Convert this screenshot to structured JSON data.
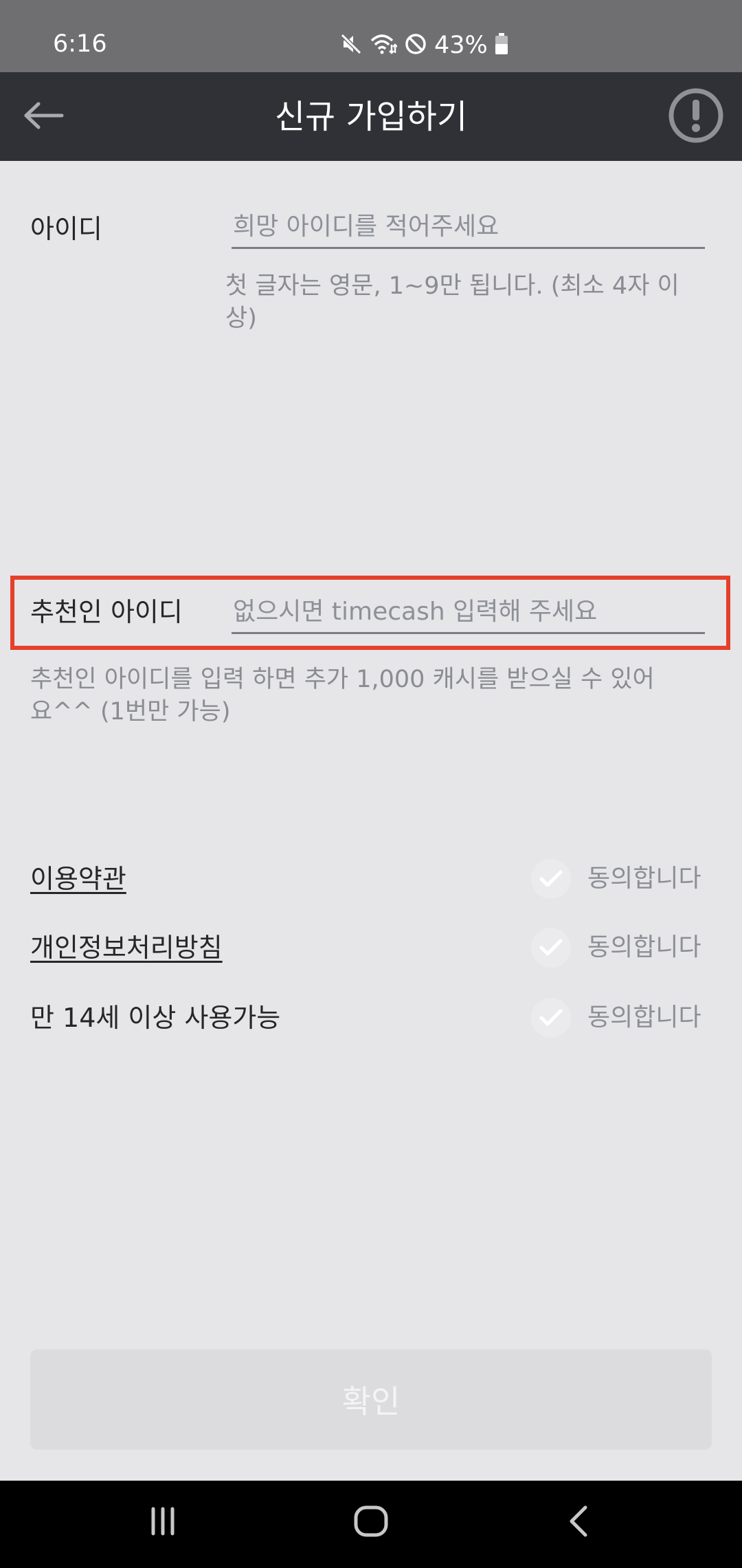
{
  "status_bar": {
    "time": "6:16",
    "battery_percent": "43%",
    "icons": [
      "mute-icon",
      "wifi-icon",
      "do-not-disturb-icon",
      "battery-icon"
    ]
  },
  "header": {
    "title": "신규 가입하기",
    "back_icon": "back-arrow-icon",
    "info_icon": "info-icon"
  },
  "form": {
    "user_id": {
      "label": "아이디",
      "placeholder": "희망 아이디를 적어주세요",
      "value": "",
      "hint": "첫 글자는 영문, 1~9만 됩니다. (최소 4자 이상)"
    },
    "referrer_id": {
      "label": "추천인 아이디",
      "placeholder": "없으시면 timecash 입력해 주세요",
      "value": "",
      "hint": "추천인 아이디를 입력 하면 추가 1,000 캐시를 받으실 수 있어요^^ (1번만 가능)"
    }
  },
  "agreements": [
    {
      "label": "이용약관",
      "agree_label": "동의합니다",
      "checked": false
    },
    {
      "label": "개인정보처리방침",
      "agree_label": "동의합니다",
      "checked": false
    },
    {
      "label": "만 14세 이상 사용가능",
      "agree_label": "동의합니다",
      "checked": false
    }
  ],
  "confirm_button": {
    "label": "확인",
    "enabled": false
  },
  "nav_bar": {
    "icons": [
      "recent-apps-icon",
      "home-icon",
      "back-icon"
    ]
  },
  "colors": {
    "status_bar": "#6f6f71",
    "header": "#2f3136",
    "background": "#e6e6e8",
    "highlight": "#e5402a",
    "button_disabled": "#dcdcdf"
  }
}
